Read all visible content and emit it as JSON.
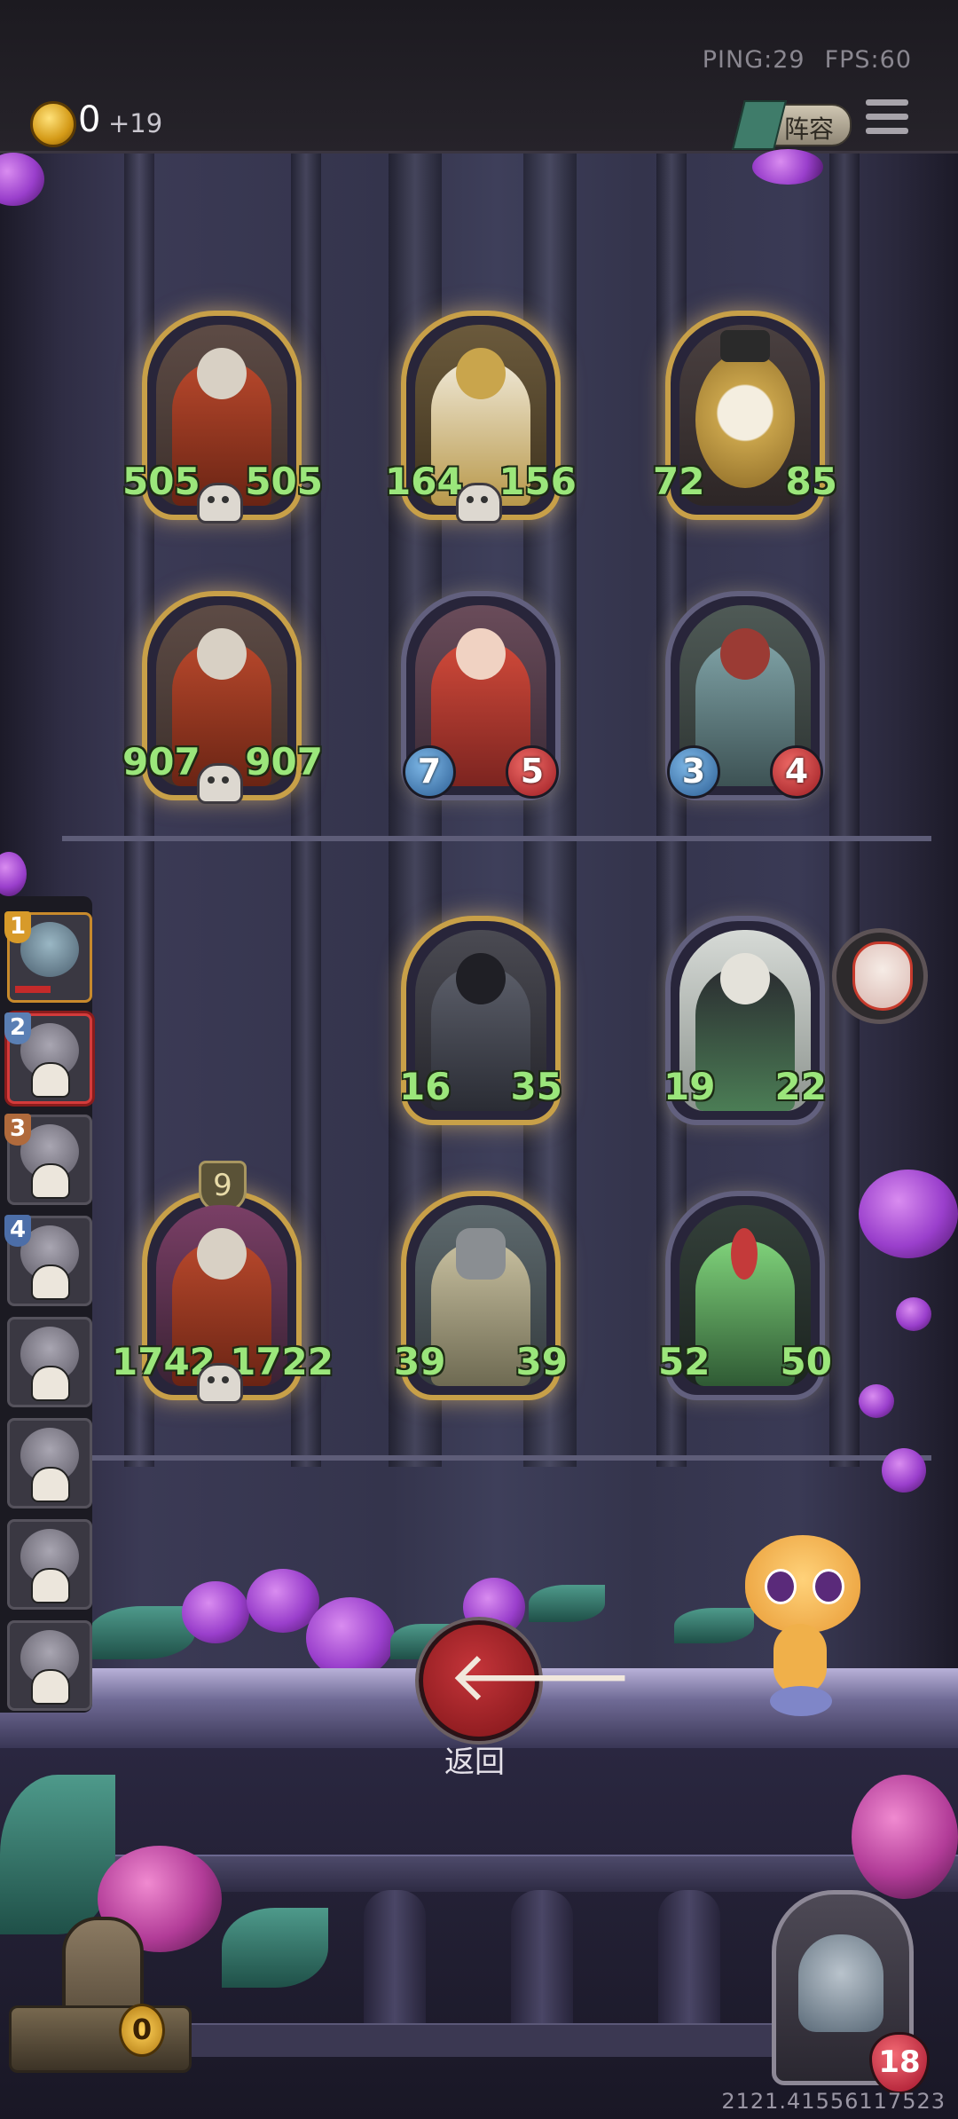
{
  "status": {
    "ping_label": "PING:29",
    "fps_label": "FPS:60"
  },
  "header": {
    "coins": "0",
    "coin_income": "+19",
    "formation_label": "阵容"
  },
  "board": {
    "cards": [
      {
        "attack": "505",
        "health": "505",
        "name": "hooded-assassin",
        "style": "numbers",
        "skull": true
      },
      {
        "attack": "164",
        "health": "156",
        "name": "golden-paladin",
        "style": "numbers",
        "skull": true
      },
      {
        "attack": "72",
        "health": "85",
        "name": "clockwork-clown",
        "style": "numbers",
        "skull": false
      },
      {
        "attack": "907",
        "health": "907",
        "name": "hooded-assassin",
        "style": "numbers",
        "skull": true
      },
      {
        "attack": "7",
        "health": "5",
        "name": "horned-girl",
        "style": "badges",
        "skull": false
      },
      {
        "attack": "3",
        "health": "4",
        "name": "moth-beast",
        "style": "badges",
        "skull": false
      },
      {
        "attack": "16",
        "health": "35",
        "name": "shadow-knight",
        "style": "numbers",
        "skull": false
      },
      {
        "attack": "19",
        "health": "22",
        "name": "reaper",
        "style": "numbers",
        "skull": false
      },
      {
        "attack": "1742",
        "health": "1722",
        "name": "hooded-assassin",
        "style": "numbers",
        "skull": true,
        "tier": "9"
      },
      {
        "attack": "39",
        "health": "39",
        "name": "knight-squire",
        "style": "numbers",
        "skull": false
      },
      {
        "attack": "52",
        "health": "50",
        "name": "thorn-golem",
        "style": "numbers",
        "skull": false
      }
    ]
  },
  "sidebar": {
    "players": [
      {
        "rank": "1"
      },
      {
        "rank": "2"
      },
      {
        "rank": "3"
      },
      {
        "rank": "4"
      },
      {
        "rank": ""
      },
      {
        "rank": ""
      },
      {
        "rank": ""
      },
      {
        "rank": ""
      }
    ]
  },
  "controls": {
    "back_label": "返回"
  },
  "hero": {
    "health": "18"
  },
  "chest": {
    "count": "0"
  },
  "footer": {
    "seed": "2121.41556117523"
  },
  "colors": {
    "stat_green": "#9be67b",
    "back_red": "#c5353a",
    "gold_frame": "#c8a048"
  }
}
